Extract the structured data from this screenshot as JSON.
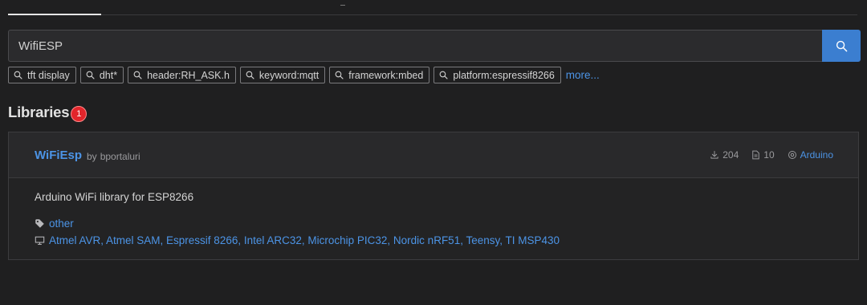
{
  "search": {
    "value": "WifiESP",
    "button_icon": "search-icon"
  },
  "chips": [
    {
      "label": "tft display",
      "icon": "search-icon"
    },
    {
      "label": "dht*",
      "icon": "search-icon"
    },
    {
      "label": "header:RH_ASK.h",
      "icon": "search-icon"
    },
    {
      "label": "keyword:mqtt",
      "icon": "search-icon"
    },
    {
      "label": "framework:mbed",
      "icon": "search-icon"
    },
    {
      "label": "platform:espressif8266",
      "icon": "search-icon"
    }
  ],
  "more_label": "more...",
  "section": {
    "title": "Libraries",
    "count": "1"
  },
  "library": {
    "name": "WiFiEsp",
    "by_label": "by",
    "author": "bportaluri",
    "downloads": "204",
    "examples": "10",
    "framework": "Arduino",
    "description": "Arduino WiFi library for ESP8266",
    "keywords": "other",
    "platforms": "Atmel AVR, Atmel SAM, Espressif 8266, Intel ARC32, Microchip PIC32, Nordic nRF51, Teensy, TI MSP430"
  },
  "colors": {
    "accent": "#3b7ed0",
    "link": "#4c94e6",
    "badge": "#e2252b",
    "background": "#1f1f20"
  }
}
